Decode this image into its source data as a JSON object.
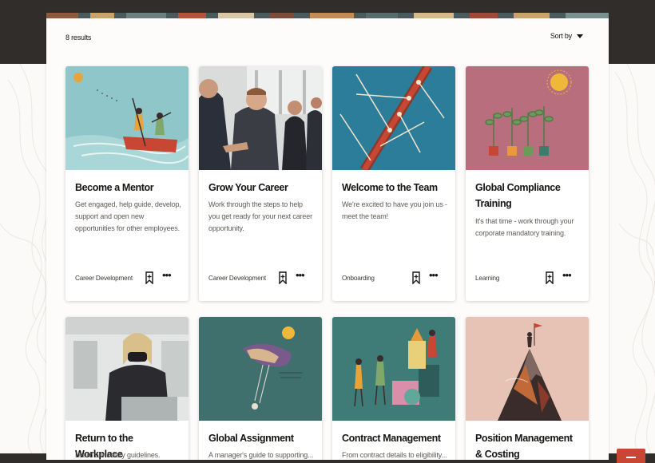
{
  "results_label": "8 results",
  "sort_label": "Sort by",
  "colors": {
    "header": "#312d2a",
    "accent": "#c74634"
  },
  "cards": [
    {
      "title": "Become a Mentor",
      "description": "Get engaged, help guide, develop, support and open new opportunities for other employees.",
      "category": "Career Development"
    },
    {
      "title": "Grow Your Career",
      "description": "Work through the steps to help you get ready for your next career opportunity.",
      "category": "Career Development"
    },
    {
      "title": "Welcome to the Team",
      "description": "We're excited to have you join us - meet the team!",
      "category": "Onboarding"
    },
    {
      "title": "Global Compliance Training",
      "description": "It's that time - work through your corporate mandatory training.",
      "category": "Learning"
    },
    {
      "title": "Return to the Workplace",
      "description": "Learn our safety guidelines.",
      "category": ""
    },
    {
      "title": "Global Assignment",
      "description": "A manager's guide to supporting...",
      "category": ""
    },
    {
      "title": "Contract Management",
      "description": "From contract details to eligibility...",
      "category": ""
    },
    {
      "title": "Position Management & Costing",
      "description": "",
      "category": ""
    }
  ],
  "icons": {
    "bookmark": "bookmark-icon",
    "more": "more-options-icon",
    "sort": "chevron-down-icon"
  }
}
